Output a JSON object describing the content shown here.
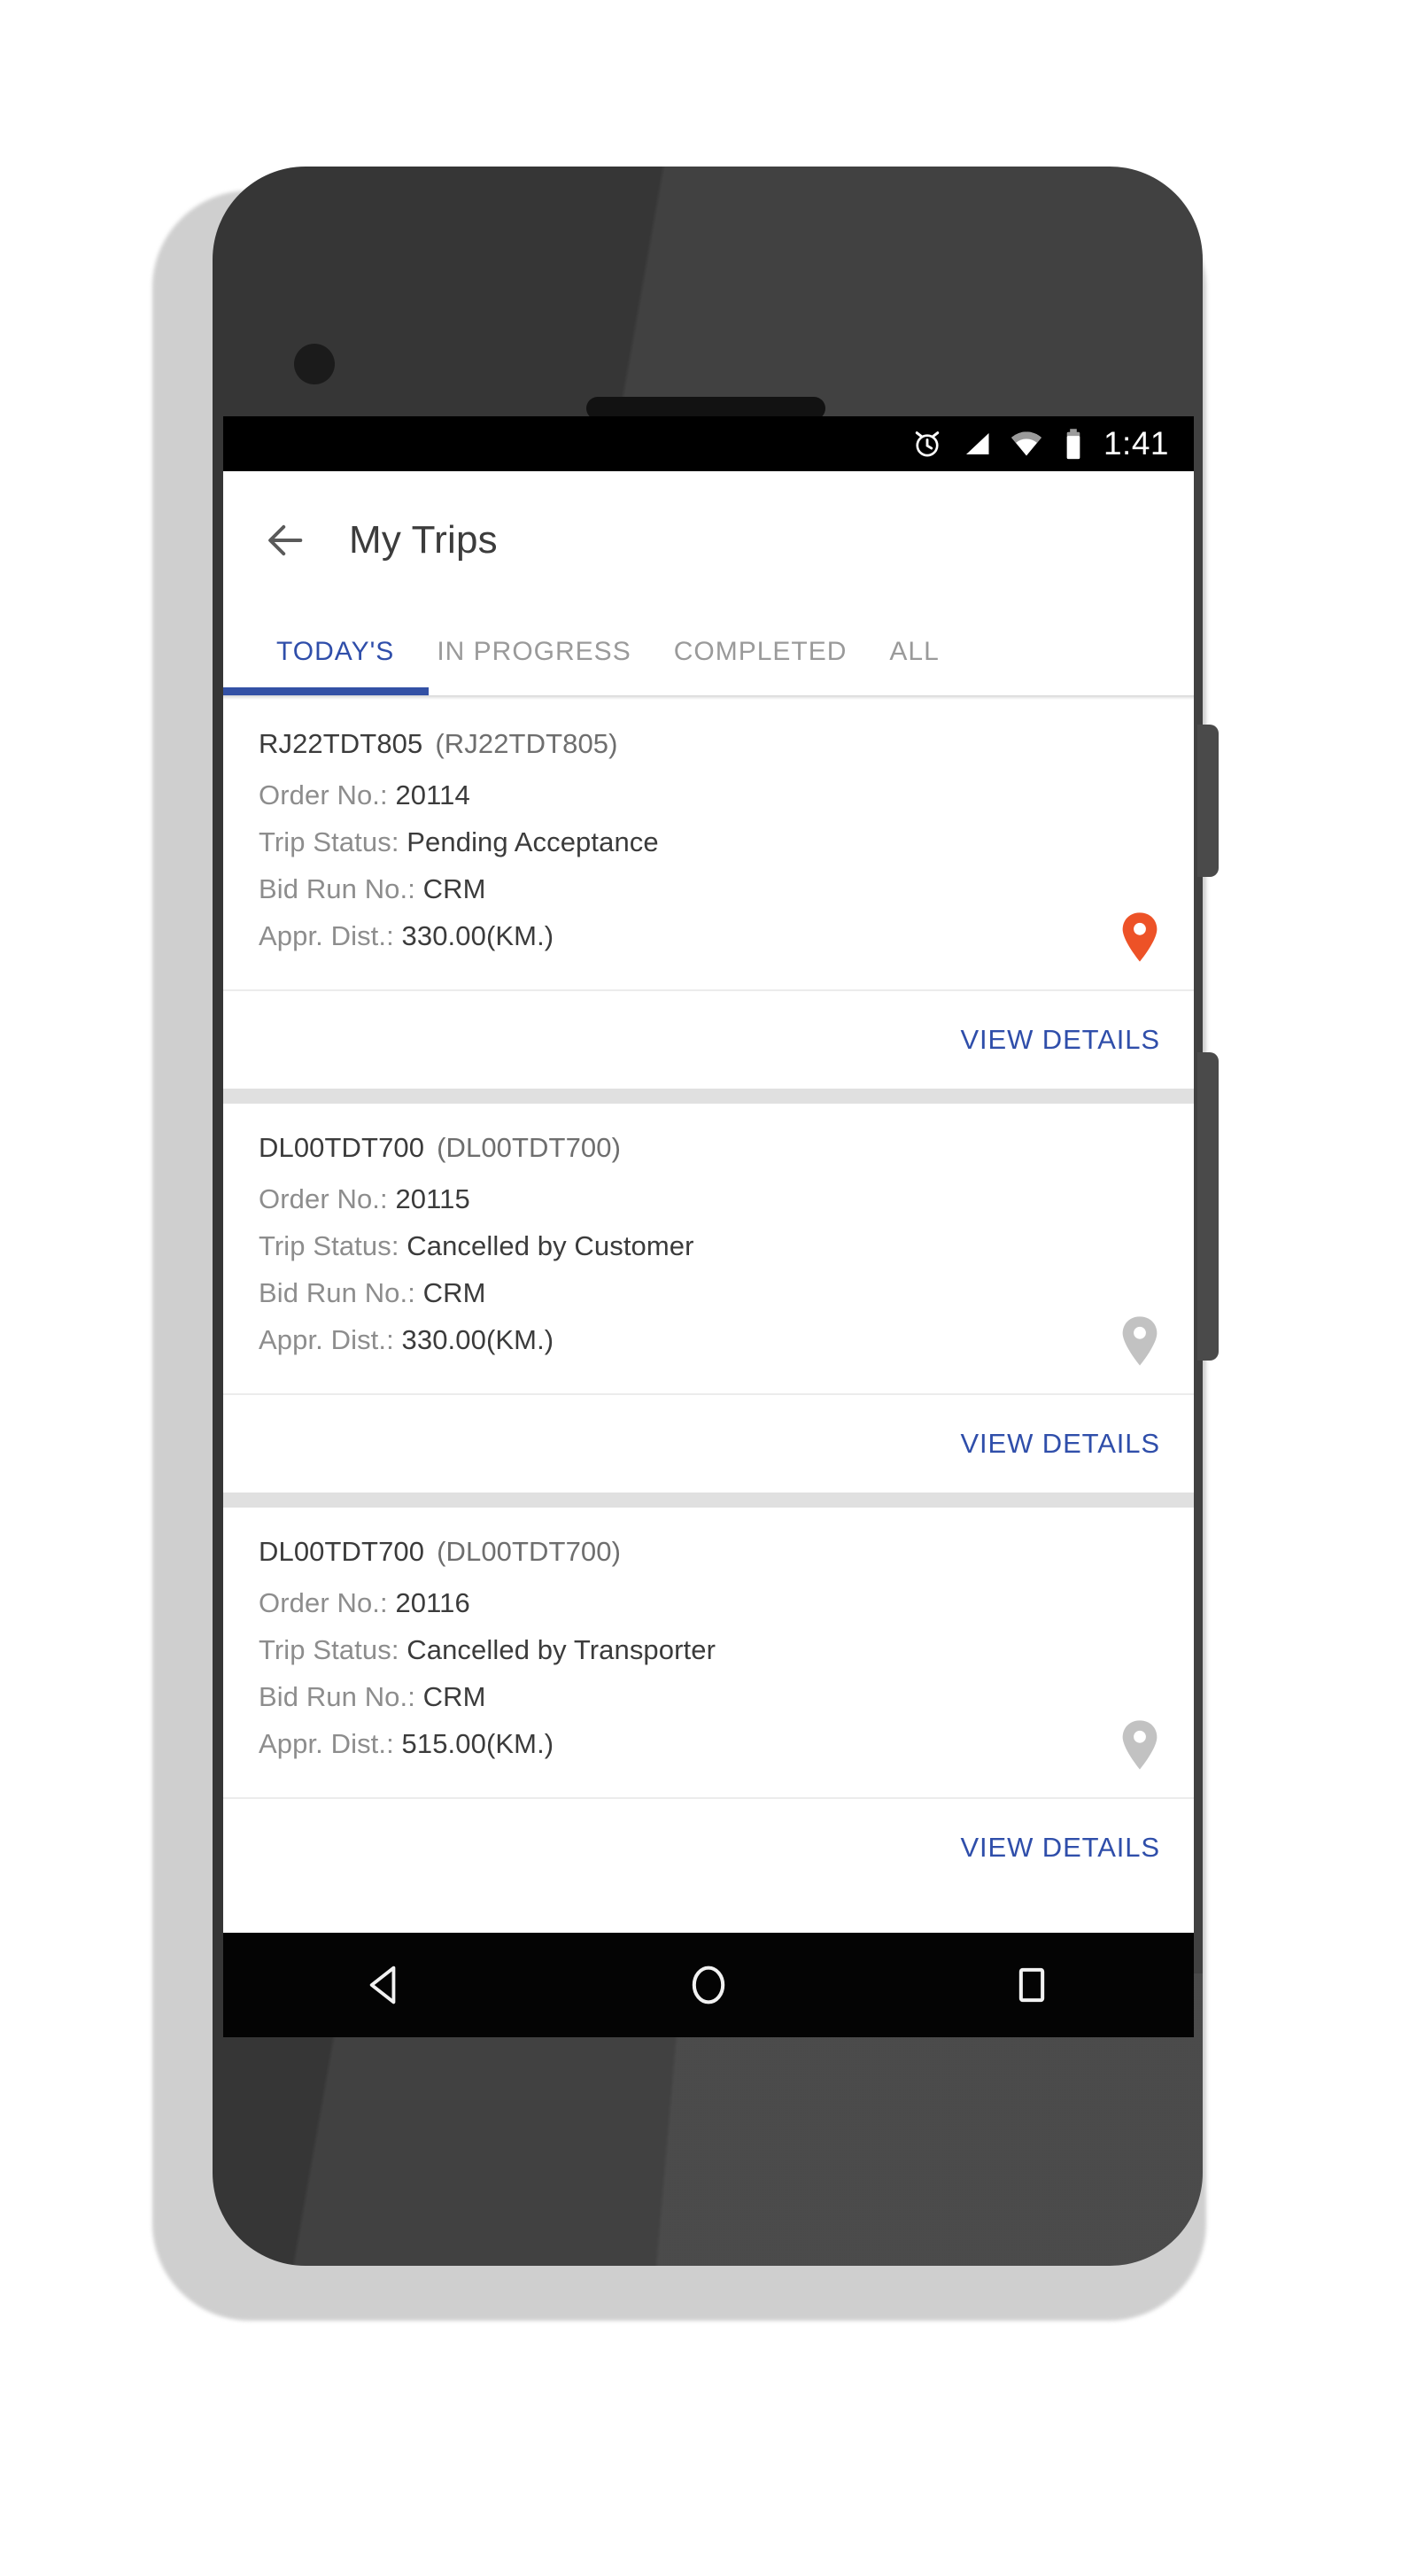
{
  "status_bar": {
    "time": "1:41",
    "icons": [
      "alarm-icon",
      "signal-icon",
      "wifi-icon",
      "battery-icon"
    ]
  },
  "app_bar": {
    "back_icon": "back-arrow-icon",
    "title": "My Trips"
  },
  "tabs": {
    "active_index": 0,
    "items": [
      {
        "label": "TODAY'S"
      },
      {
        "label": "IN PROGRESS"
      },
      {
        "label": "COMPLETED"
      },
      {
        "label": "ALL"
      }
    ]
  },
  "labels": {
    "order_no": "Order No.:",
    "trip_status": "Trip Status:",
    "bid_run_no": "Bid Run No.:",
    "appr_dist": "Appr. Dist.:",
    "view_details": "VIEW DETAILS"
  },
  "colors": {
    "accent_blue": "#2f4eaa",
    "tab_indicator": "#3351a5",
    "pin_active": "#ed5227",
    "pin_inactive": "#c2c2c2",
    "label_grey": "#8d8d8d",
    "value_dark": "#3b3b3b",
    "list_background": "#e0e0e0"
  },
  "trips": [
    {
      "vehicle_no": "RJ22TDT805",
      "vehicle_no_paren": "(RJ22TDT805)",
      "order_no": "20114",
      "trip_status": "Pending Acceptance",
      "bid_run_no": "CRM",
      "appr_dist": "330.00(KM.)",
      "pin_state": "active",
      "view_details": "VIEW DETAILS"
    },
    {
      "vehicle_no": "DL00TDT700",
      "vehicle_no_paren": "(DL00TDT700)",
      "order_no": "20115",
      "trip_status": "Cancelled by Customer",
      "bid_run_no": "CRM",
      "appr_dist": "330.00(KM.)",
      "pin_state": "inactive",
      "view_details": "VIEW DETAILS"
    },
    {
      "vehicle_no": "DL00TDT700",
      "vehicle_no_paren": "(DL00TDT700)",
      "order_no": "20116",
      "trip_status": "Cancelled by Transporter",
      "bid_run_no": "CRM",
      "appr_dist": "515.00(KM.)",
      "pin_state": "inactive",
      "view_details": "VIEW DETAILS"
    }
  ],
  "nav_bar": {
    "back": "nav-back-icon",
    "home": "nav-home-icon",
    "recents": "nav-recents-icon"
  }
}
